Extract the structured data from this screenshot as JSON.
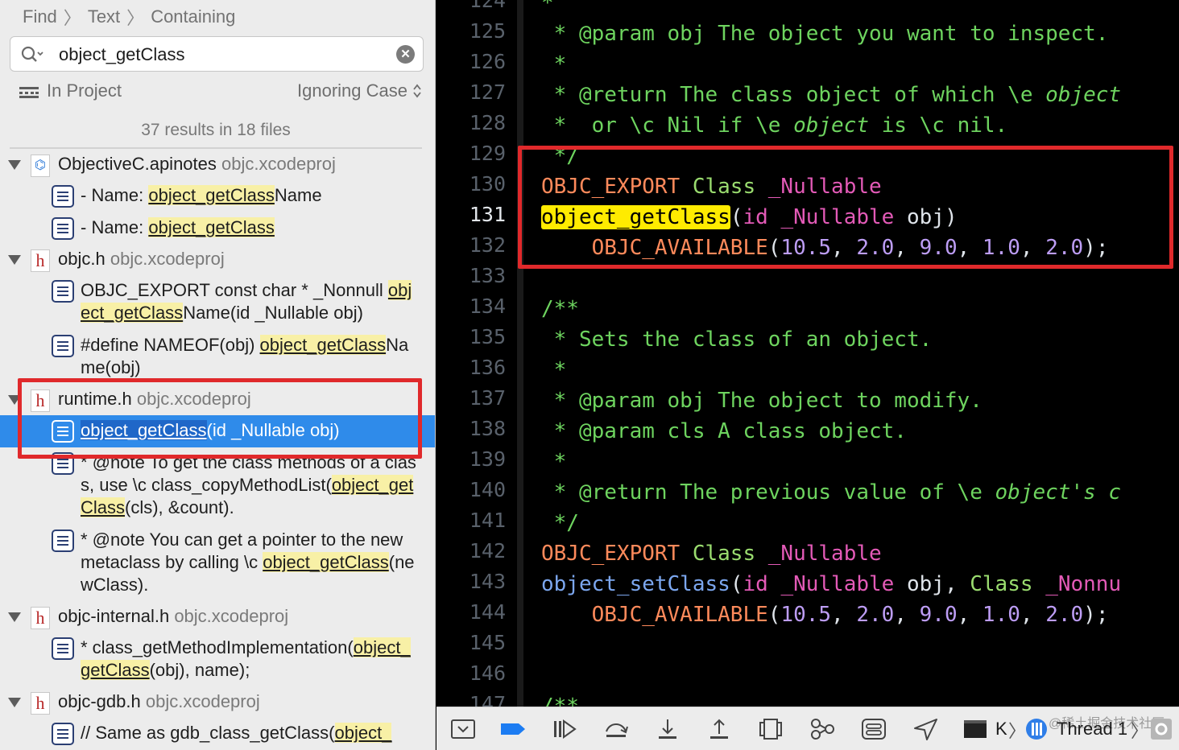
{
  "navigator": {
    "breadcrumb": [
      "Find",
      "Text",
      "Containing"
    ],
    "search": {
      "query": "object_getClass"
    },
    "scope": {
      "project": "In Project",
      "case": "Ignoring Case"
    },
    "result_count": "37 results in 18 files",
    "groups": [
      {
        "file": "ObjectiveC.apinotes",
        "project": "objc.xcodeproj",
        "results": [
          {
            "pre": "- Name: ",
            "match": "object_getClass",
            "post": "Name"
          },
          {
            "pre": "- Name: ",
            "match": "object_getClass",
            "post": ""
          }
        ]
      },
      {
        "file": "objc.h",
        "project": "objc.xcodeproj",
        "results": [
          {
            "pre": "OBJC_EXPORT const char * _Nonnull ",
            "match": "object_getClass",
            "post": "Name(id _Nullable obj)"
          },
          {
            "pre": "#define NAMEOF(obj)     ",
            "match": "object_getClass",
            "post": "Name(obj)"
          }
        ]
      },
      {
        "file": "runtime.h",
        "project": "objc.xcodeproj",
        "results": [
          {
            "pre": "",
            "match": "object_getClass",
            "post": "(id _Nullable obj)",
            "selected": true
          },
          {
            "pre": "* @note To get the class methods of a class, use \\c class_copyMethodList(",
            "match": "object_getClass",
            "post": "(cls), &count)."
          },
          {
            "pre": "* @note You can get a pointer to the new metaclass by calling \\c ",
            "match": "object_getClass",
            "post": "(newClass)."
          }
        ]
      },
      {
        "file": "objc-internal.h",
        "project": "objc.xcodeproj",
        "results": [
          {
            "pre": "* class_getMethodImplementation(",
            "match": "object_getClass",
            "post": "(obj), name);"
          }
        ]
      },
      {
        "file": "objc-gdb.h",
        "project": "objc.xcodeproj",
        "results": [
          {
            "pre": "// Same as gdb_class_getClass(",
            "match": "object_",
            "post": ""
          }
        ]
      }
    ]
  },
  "editor": {
    "current_line": 131,
    "line_numbers": [
      124,
      125,
      126,
      127,
      128,
      129,
      130,
      131,
      132,
      133,
      134,
      135,
      136,
      137,
      138,
      139,
      140,
      141,
      142,
      143,
      144,
      145,
      146,
      147
    ],
    "lines": [
      [
        {
          "t": "*",
          "c": "cmt"
        }
      ],
      [
        {
          "t": " * @param obj The object you want to inspect.",
          "c": "cmt"
        }
      ],
      [
        {
          "t": " *",
          "c": "cmt"
        }
      ],
      [
        {
          "t": " * @return The class object of which \\e ",
          "c": "cmt"
        },
        {
          "t": "object",
          "c": "cmtit"
        }
      ],
      [
        {
          "t": " *  or \\c Nil if \\e ",
          "c": "cmt"
        },
        {
          "t": "object",
          "c": "cmtit"
        },
        {
          "t": " is \\c nil.",
          "c": "cmt"
        }
      ],
      [
        {
          "t": " */",
          "c": "cmt"
        }
      ],
      [
        {
          "t": "OBJC_EXPORT",
          "c": "kw"
        },
        {
          "t": " ",
          "c": "pl"
        },
        {
          "t": "Class",
          "c": "ty"
        },
        {
          "t": " ",
          "c": "pl"
        },
        {
          "t": "_Nullable",
          "c": "nl"
        }
      ],
      [
        {
          "t": "object_getClass",
          "c": "hl"
        },
        {
          "t": "(",
          "c": "pl"
        },
        {
          "t": "id",
          "c": "nl"
        },
        {
          "t": " ",
          "c": "pl"
        },
        {
          "t": "_Nullable",
          "c": "nl"
        },
        {
          "t": " obj)",
          "c": "pl"
        }
      ],
      [
        {
          "t": "    OBJC_AVAILABLE",
          "c": "kw"
        },
        {
          "t": "(",
          "c": "pl"
        },
        {
          "t": "10.5",
          "c": "num"
        },
        {
          "t": ", ",
          "c": "pl"
        },
        {
          "t": "2.0",
          "c": "num"
        },
        {
          "t": ", ",
          "c": "pl"
        },
        {
          "t": "9.0",
          "c": "num"
        },
        {
          "t": ", ",
          "c": "pl"
        },
        {
          "t": "1.0",
          "c": "num"
        },
        {
          "t": ", ",
          "c": "pl"
        },
        {
          "t": "2.0",
          "c": "num"
        },
        {
          "t": ");",
          "c": "pl"
        }
      ],
      [],
      [
        {
          "t": "/**",
          "c": "cmt"
        }
      ],
      [
        {
          "t": " * Sets the class of an object.",
          "c": "cmt"
        }
      ],
      [
        {
          "t": " *",
          "c": "cmt"
        }
      ],
      [
        {
          "t": " * @param obj The object to modify.",
          "c": "cmt"
        }
      ],
      [
        {
          "t": " * @param cls A class object.",
          "c": "cmt"
        }
      ],
      [
        {
          "t": " *",
          "c": "cmt"
        }
      ],
      [
        {
          "t": " * @return The previous value of \\e ",
          "c": "cmt"
        },
        {
          "t": "object's c",
          "c": "cmtit"
        }
      ],
      [
        {
          "t": " */",
          "c": "cmt"
        }
      ],
      [
        {
          "t": "OBJC_EXPORT",
          "c": "kw"
        },
        {
          "t": " ",
          "c": "pl"
        },
        {
          "t": "Class",
          "c": "ty"
        },
        {
          "t": " ",
          "c": "pl"
        },
        {
          "t": "_Nullable",
          "c": "nl"
        }
      ],
      [
        {
          "t": "object_setClass",
          "c": "fn"
        },
        {
          "t": "(",
          "c": "pl"
        },
        {
          "t": "id",
          "c": "nl"
        },
        {
          "t": " ",
          "c": "pl"
        },
        {
          "t": "_Nullable",
          "c": "nl"
        },
        {
          "t": " obj, ",
          "c": "pl"
        },
        {
          "t": "Class",
          "c": "ty"
        },
        {
          "t": " ",
          "c": "pl"
        },
        {
          "t": "_Nonnu",
          "c": "nl"
        }
      ],
      [
        {
          "t": "    OBJC_AVAILABLE",
          "c": "kw"
        },
        {
          "t": "(",
          "c": "pl"
        },
        {
          "t": "10.5",
          "c": "num"
        },
        {
          "t": ", ",
          "c": "pl"
        },
        {
          "t": "2.0",
          "c": "num"
        },
        {
          "t": ", ",
          "c": "pl"
        },
        {
          "t": "9.0",
          "c": "num"
        },
        {
          "t": ", ",
          "c": "pl"
        },
        {
          "t": "1.0",
          "c": "num"
        },
        {
          "t": ", ",
          "c": "pl"
        },
        {
          "t": "2.0",
          "c": "num"
        },
        {
          "t": ");",
          "c": "pl"
        }
      ],
      [],
      [],
      [
        {
          "t": "/**",
          "c": "cmt"
        }
      ]
    ]
  },
  "debug_bar": {
    "buttons": [
      "hide-debug-area",
      "breakpoints-toggle",
      "continue",
      "step-over",
      "step-into",
      "step-out",
      "view-hierarchy",
      "memory-graph",
      "environment-overrides",
      "simulate-location"
    ],
    "process": "K",
    "thread": "Thread 1",
    "watermark": "@稀土掘金技术社区"
  }
}
